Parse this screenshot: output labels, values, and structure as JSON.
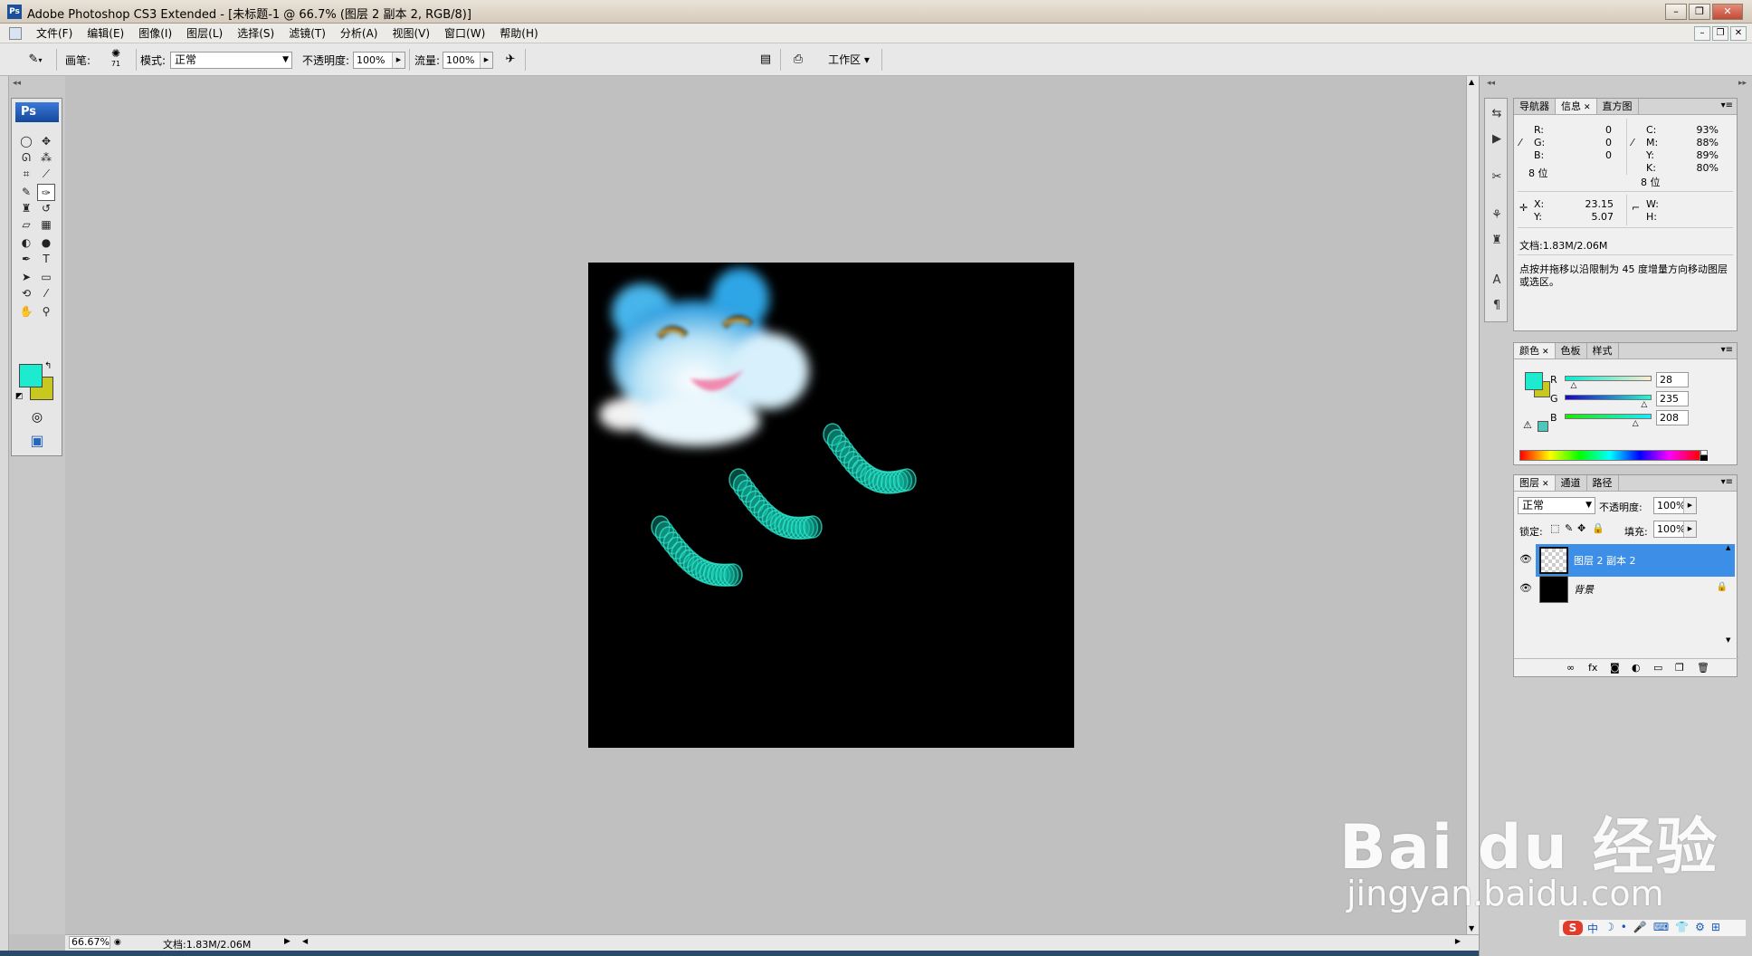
{
  "window": {
    "title": "Adobe Photoshop CS3 Extended - [未标题-1 @ 66.7% (图层 2 副本 2, RGB/8)]",
    "app_icon": "Ps",
    "controls": {
      "minimize": "–",
      "restore": "❐",
      "close": "✕"
    }
  },
  "menu": {
    "items": [
      "文件(F)",
      "编辑(E)",
      "图像(I)",
      "图层(L)",
      "选择(S)",
      "滤镜(T)",
      "分析(A)",
      "视图(V)",
      "窗口(W)",
      "帮助(H)"
    ],
    "doc_controls": {
      "minimize": "–",
      "restore": "❐",
      "close": "✕"
    }
  },
  "options": {
    "brush_label": "画笔:",
    "brush_size": "71",
    "mode_label": "模式:",
    "mode_value": "正常",
    "opacity_label": "不透明度:",
    "opacity_value": "100%",
    "flow_label": "流量:",
    "flow_value": "100%",
    "workspace_label": "工作区 ▾"
  },
  "toolbox": {
    "logo": "Ps",
    "tools": [
      {
        "name": "marquee-tool-icon",
        "glyph": "◯"
      },
      {
        "name": "move-tool-icon",
        "glyph": "✥"
      },
      {
        "name": "lasso-tool-icon",
        "glyph": "ᘏ"
      },
      {
        "name": "magic-wand-tool-icon",
        "glyph": "⁂"
      },
      {
        "name": "crop-tool-icon",
        "glyph": "⌗"
      },
      {
        "name": "slice-tool-icon",
        "glyph": "⟋"
      },
      {
        "name": "healing-brush-tool-icon",
        "glyph": "✎"
      },
      {
        "name": "brush-tool-icon",
        "glyph": "✑"
      },
      {
        "name": "stamp-tool-icon",
        "glyph": "♜"
      },
      {
        "name": "history-brush-tool-icon",
        "glyph": "↺"
      },
      {
        "name": "eraser-tool-icon",
        "glyph": "▱"
      },
      {
        "name": "gradient-tool-icon",
        "glyph": "▦"
      },
      {
        "name": "blur-tool-icon",
        "glyph": "◐"
      },
      {
        "name": "dodge-tool-icon",
        "glyph": "●"
      },
      {
        "name": "pen-tool-icon",
        "glyph": "✒"
      },
      {
        "name": "type-tool-icon",
        "glyph": "T"
      },
      {
        "name": "path-selection-tool-icon",
        "glyph": "➤"
      },
      {
        "name": "shape-tool-icon",
        "glyph": "▭"
      },
      {
        "name": "3d-rotate-tool-icon",
        "glyph": "⟲"
      },
      {
        "name": "eyedropper-tool-icon",
        "glyph": "⁄"
      },
      {
        "name": "hand-tool-icon",
        "glyph": "✋"
      },
      {
        "name": "zoom-tool-icon",
        "glyph": "⚲"
      }
    ],
    "foreground_color": "#1cebd0",
    "background_color": "#c8c81e",
    "quickmask_glyph": "◎",
    "screenmode_glyph": "▣"
  },
  "status": {
    "zoom": "66.67%",
    "doc_info": "文档:1.83M/2.06M"
  },
  "info_panel": {
    "tabs": [
      "导航器",
      "信息",
      "直方图"
    ],
    "rgb": {
      "R": "0",
      "G": "0",
      "B": "0"
    },
    "cmyk": {
      "C": "93%",
      "M": "88%",
      "Y": "89%",
      "K": "80%"
    },
    "bits_left": "8 位",
    "bits_right": "8 位",
    "xy": {
      "X": "23.15",
      "Y": "5.07"
    },
    "wh": {
      "W": "",
      "H": ""
    },
    "doc": "文档:1.83M/2.06M",
    "hint": "点按并拖移以沿限制为 45 度增量方向移动图层或选区。"
  },
  "color_panel": {
    "tabs": [
      "颜色",
      "色板",
      "样式"
    ],
    "channels": [
      {
        "label": "R",
        "value": "28",
        "fraction": 0.11
      },
      {
        "label": "G",
        "value": "235",
        "fraction": 0.92
      },
      {
        "label": "B",
        "value": "208",
        "fraction": 0.82
      }
    ],
    "fg": "#1cebd0",
    "bg": "#c8c81e"
  },
  "layers_panel": {
    "tabs": [
      "图层",
      "通道",
      "路径"
    ],
    "blend_mode": "正常",
    "opacity_label": "不透明度:",
    "opacity_value": "100%",
    "lock_label": "锁定:",
    "fill_label": "填充:",
    "fill_value": "100%",
    "layers": [
      {
        "name": "图层 2 副本 2",
        "selected": true
      },
      {
        "name": "背景",
        "selected": false
      }
    ]
  },
  "watermark": {
    "logo": "Bai du 经验",
    "url": "jingyan.baidu.com"
  },
  "tray": {
    "ime": "S",
    "items": [
      "中",
      "☽",
      "•",
      "🎤",
      "⌨",
      "👕",
      "⚙",
      "⊞"
    ]
  }
}
